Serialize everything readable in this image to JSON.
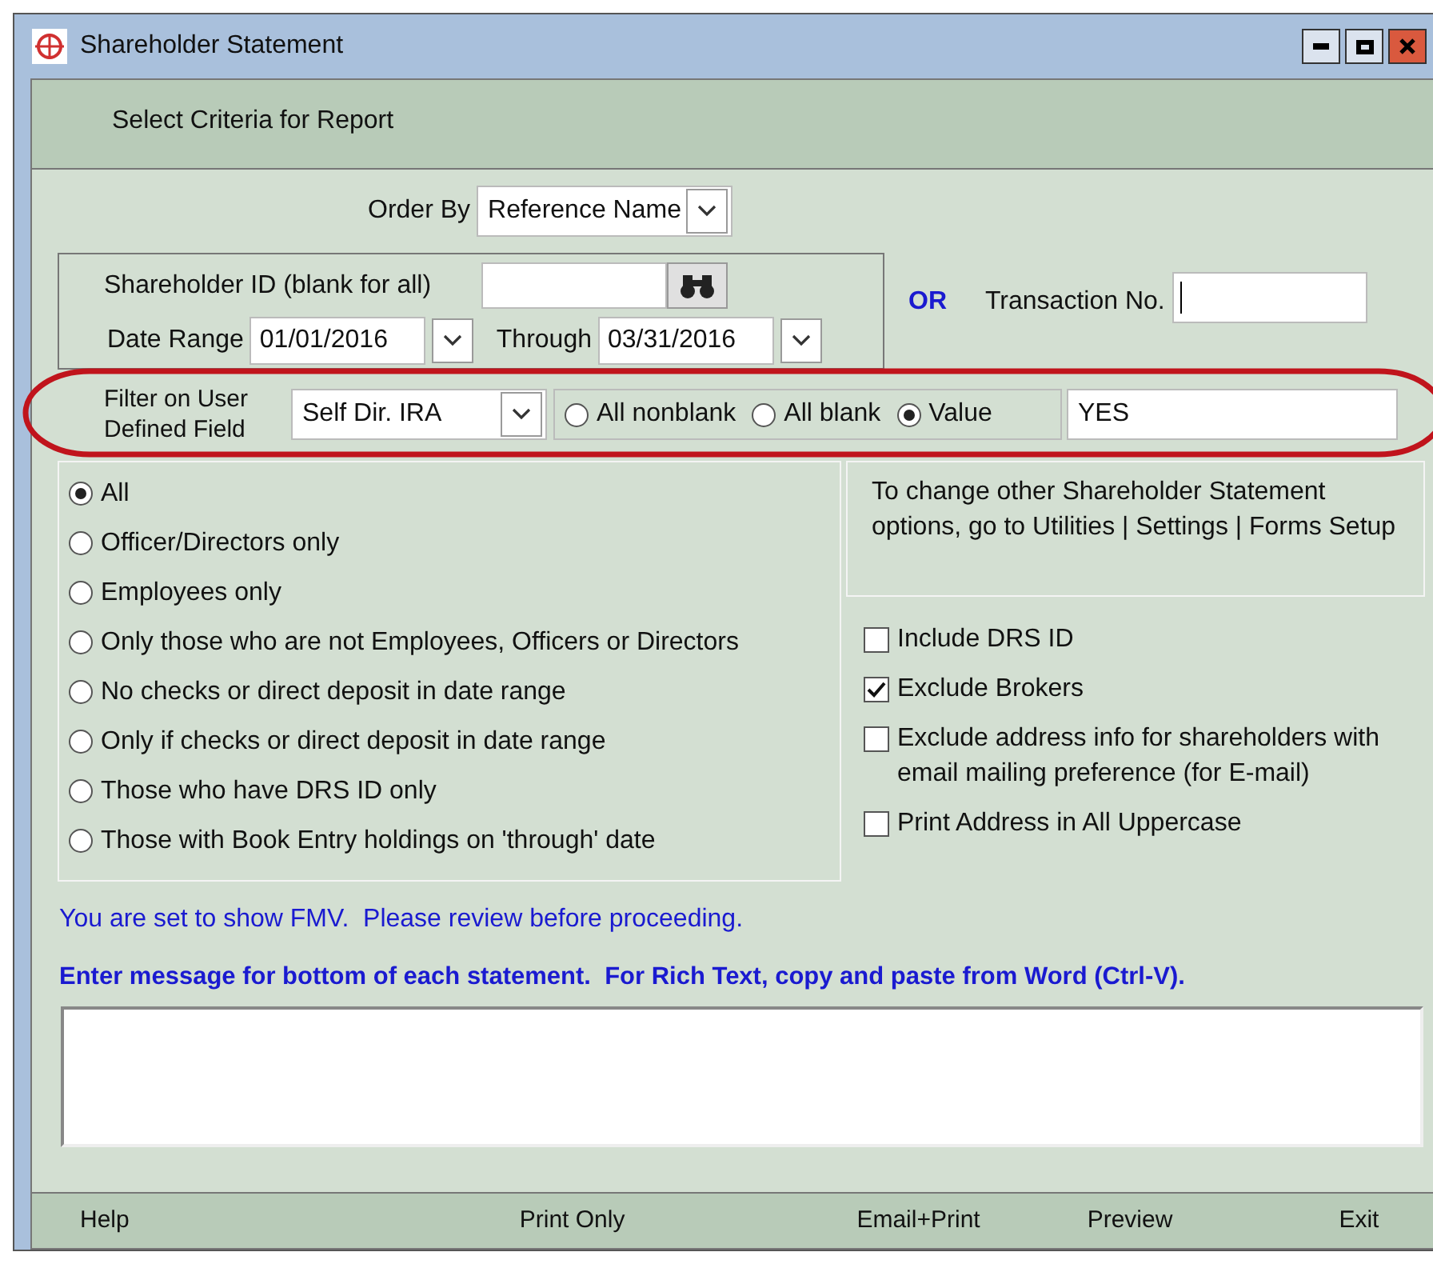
{
  "window": {
    "title": "Shareholder Statement"
  },
  "header": {
    "title": "Select Criteria for Report"
  },
  "order_by": {
    "label": "Order By",
    "value": "Reference Name"
  },
  "shareholder_id": {
    "label": "Shareholder ID (blank for all)"
  },
  "date_range": {
    "label": "Date Range",
    "from": "01/01/2016",
    "through_label": "Through",
    "to": "03/31/2016"
  },
  "or_label": "OR",
  "transaction_no": {
    "label": "Transaction No."
  },
  "filter": {
    "label": "Filter on User Defined Field",
    "field": "Self Dir. IRA",
    "options": [
      {
        "label": "All nonblank",
        "selected": false
      },
      {
        "label": "All blank",
        "selected": false
      },
      {
        "label": "Value",
        "selected": true
      }
    ],
    "value": "YES"
  },
  "scope_options": [
    {
      "label": "All",
      "selected": true
    },
    {
      "label": "Officer/Directors only",
      "selected": false
    },
    {
      "label": "Employees only",
      "selected": false
    },
    {
      "label": "Only those who are not Employees, Officers or Directors",
      "selected": false
    },
    {
      "label": "No checks or direct deposit in date range",
      "selected": false
    },
    {
      "label": "Only if checks or direct deposit in date range",
      "selected": false
    },
    {
      "label": "Those who have DRS ID only",
      "selected": false
    },
    {
      "label": "Those with Book Entry holdings on 'through' date",
      "selected": false
    }
  ],
  "info_text": "To change other Shareholder Statement options, go to Utilities | Settings | Forms Setup",
  "checkboxes": [
    {
      "label": "Include DRS ID",
      "checked": false
    },
    {
      "label": "Exclude Brokers",
      "checked": true
    },
    {
      "label": "Exclude address info for shareholders with email mailing preference (for E-mail)",
      "checked": false
    },
    {
      "label": "Print Address in All Uppercase",
      "checked": false
    }
  ],
  "fmv_notice": "You are set to show FMV.  Please review before proceeding.",
  "message_prompt": "Enter message for bottom of each statement.  For Rich Text, copy and paste from Word (Ctrl-V).",
  "buttons": [
    "Help",
    "Print Only",
    "Email+Print",
    "Preview",
    "Exit"
  ]
}
